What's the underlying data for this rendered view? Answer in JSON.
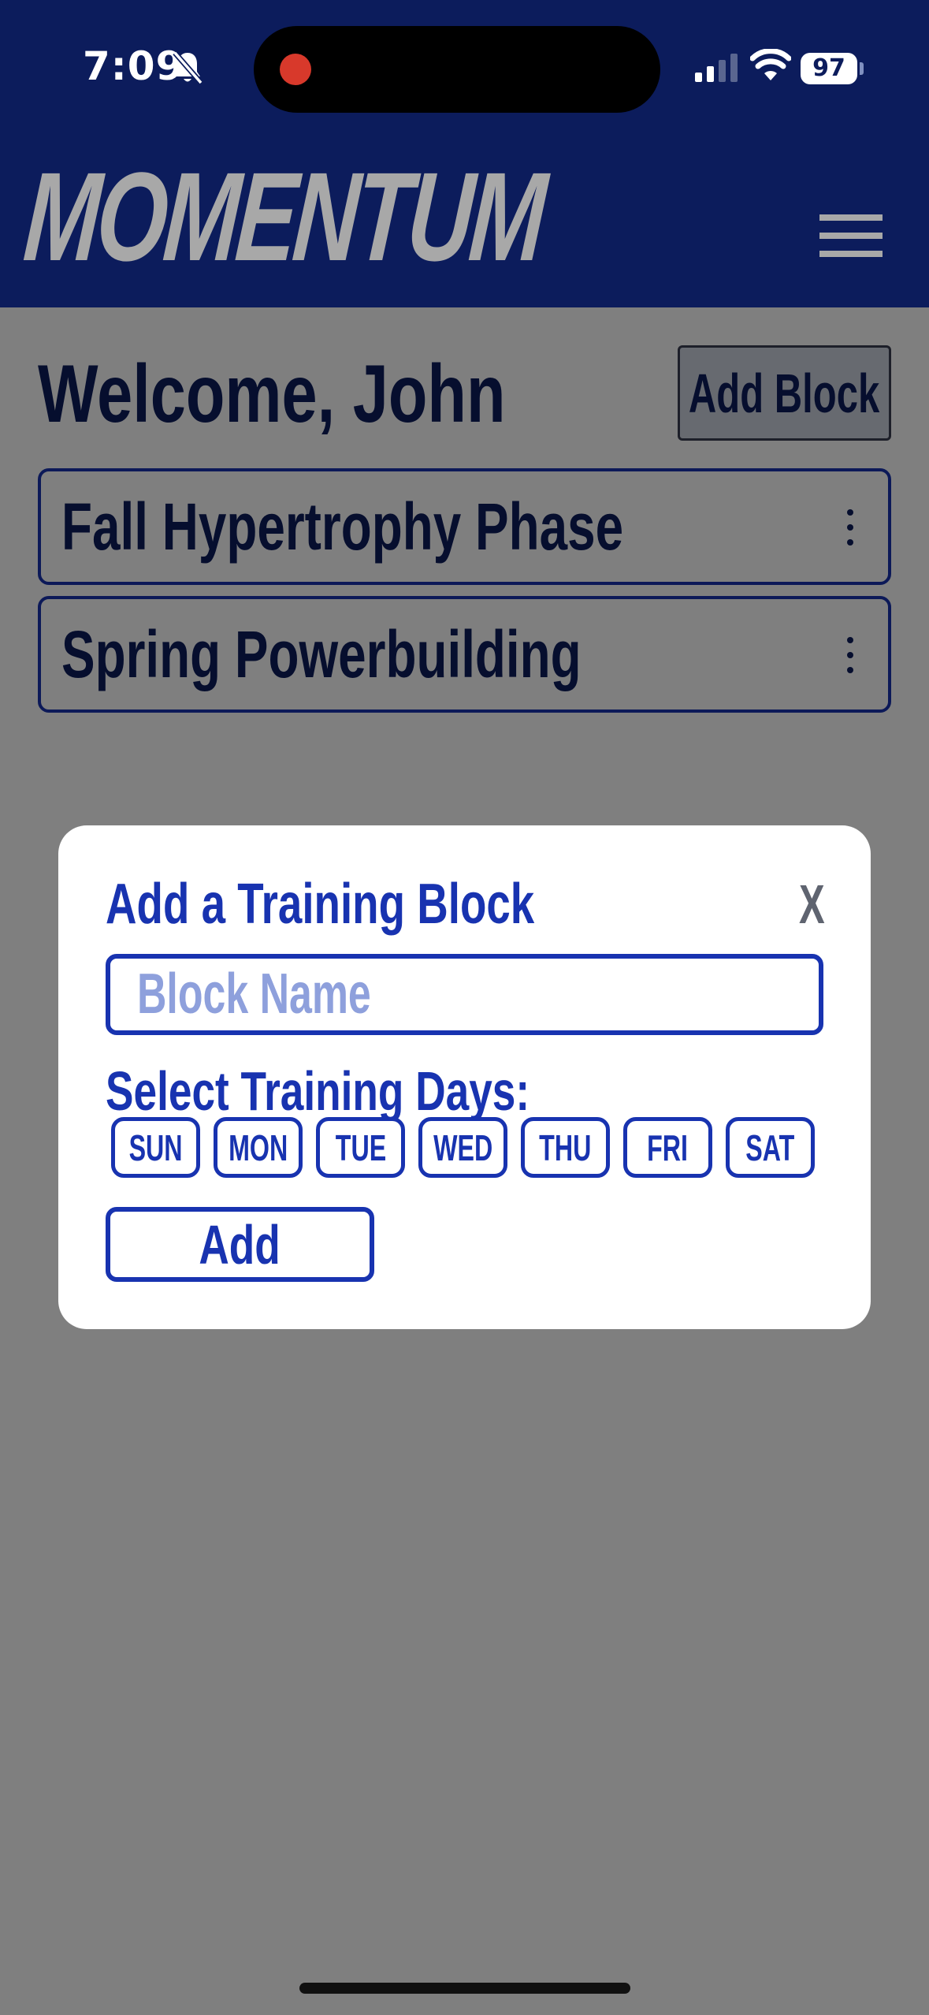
{
  "status_bar": {
    "time": "7:09",
    "battery": "97",
    "icons": [
      "bell-slash-icon",
      "cellular-signal-icon",
      "wifi-icon",
      "battery-icon"
    ],
    "recording_indicator_color": "#d8392b"
  },
  "header": {
    "logo": "MOMENTUM",
    "menu_icon": "hamburger-menu-icon",
    "background": "#0c1c5c"
  },
  "main": {
    "welcome": "Welcome, John",
    "add_block_label": "Add Block",
    "blocks": [
      {
        "name": "Fall Hypertrophy Phase",
        "menu_icon": "kebab-menu-icon"
      },
      {
        "name": "Spring Powerbuilding",
        "menu_icon": "kebab-menu-icon"
      }
    ]
  },
  "modal": {
    "title": "Add a Training Block",
    "close_label": "X",
    "name_input": {
      "value": "",
      "placeholder": "Block Name"
    },
    "days_label": "Select Training Days:",
    "days": [
      "SUN",
      "MON",
      "TUE",
      "WED",
      "THU",
      "FRI",
      "SAT"
    ],
    "submit_label": "Add"
  },
  "colors": {
    "primary": "#1833b0",
    "navy": "#0c1c5c",
    "logo_gray": "#a8a8a8",
    "overlay": "rgba(0,0,0,0.5)"
  }
}
